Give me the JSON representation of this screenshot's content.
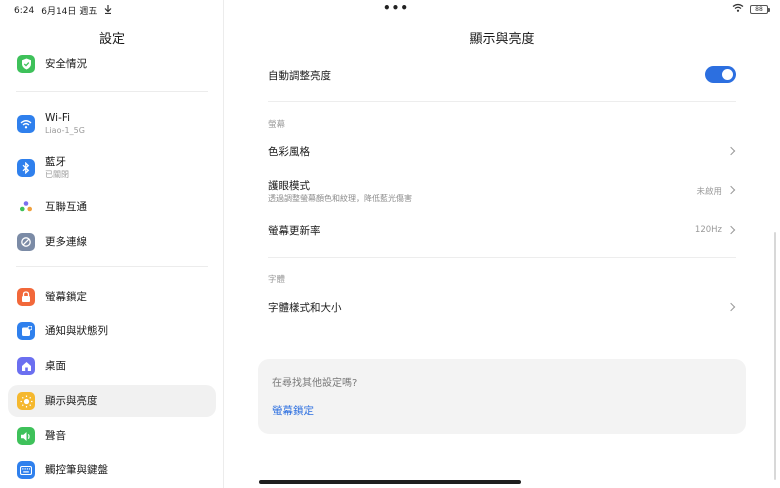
{
  "status_bar": {
    "time": "6:24",
    "date": "6月14日",
    "weekday": "週五",
    "download_icon": "download-arrow-icon",
    "center_dots": "•••",
    "battery": "88"
  },
  "sidebar": {
    "title": "設定",
    "items": [
      {
        "label": "安全情況",
        "sub": "",
        "icon": "shield-check-icon",
        "color": "#3ec15a"
      },
      {
        "label": "Wi-Fi",
        "sub": "Liao-1_5G",
        "icon": "wifi-icon",
        "color": "#2f80ed"
      },
      {
        "label": "藍牙",
        "sub": "已關閉",
        "icon": "bluetooth-icon",
        "color": "#2f80ed"
      },
      {
        "label": "互聯互通",
        "sub": "",
        "icon": "dots-cluster-icon",
        "color": "#ffffff"
      },
      {
        "label": "更多連線",
        "sub": "",
        "icon": "link-icon",
        "color": "#7b8ba6"
      },
      {
        "label": "螢幕鎖定",
        "sub": "",
        "icon": "lock-icon",
        "color": "#f2683a"
      },
      {
        "label": "通知與狀態列",
        "sub": "",
        "icon": "notification-icon",
        "color": "#2f80ed"
      },
      {
        "label": "桌面",
        "sub": "",
        "icon": "home-icon",
        "color": "#6b6ff0"
      },
      {
        "label": "顯示與亮度",
        "sub": "",
        "icon": "sun-icon",
        "color": "#f5b82e"
      },
      {
        "label": "聲音",
        "sub": "",
        "icon": "speaker-icon",
        "color": "#3ec15a"
      },
      {
        "label": "觸控筆與鍵盤",
        "sub": "",
        "icon": "keyboard-icon",
        "color": "#2f80ed"
      }
    ]
  },
  "main": {
    "title": "顯示與亮度",
    "auto_brightness": {
      "label": "自動調整亮度",
      "enabled": true
    },
    "screen_section": "螢幕",
    "color_style": {
      "label": "色彩風格"
    },
    "eye_care": {
      "label": "護眼模式",
      "sub": "透過調整螢幕顏色和紋理，降低藍光傷害",
      "value": "未啟用"
    },
    "refresh_rate": {
      "label": "螢幕更新率",
      "value": "120Hz"
    },
    "font_section": "字體",
    "font_style": {
      "label": "字體樣式和大小"
    },
    "suggestion": {
      "question": "在尋找其他設定嗎?",
      "link": "螢幕鎖定"
    }
  }
}
